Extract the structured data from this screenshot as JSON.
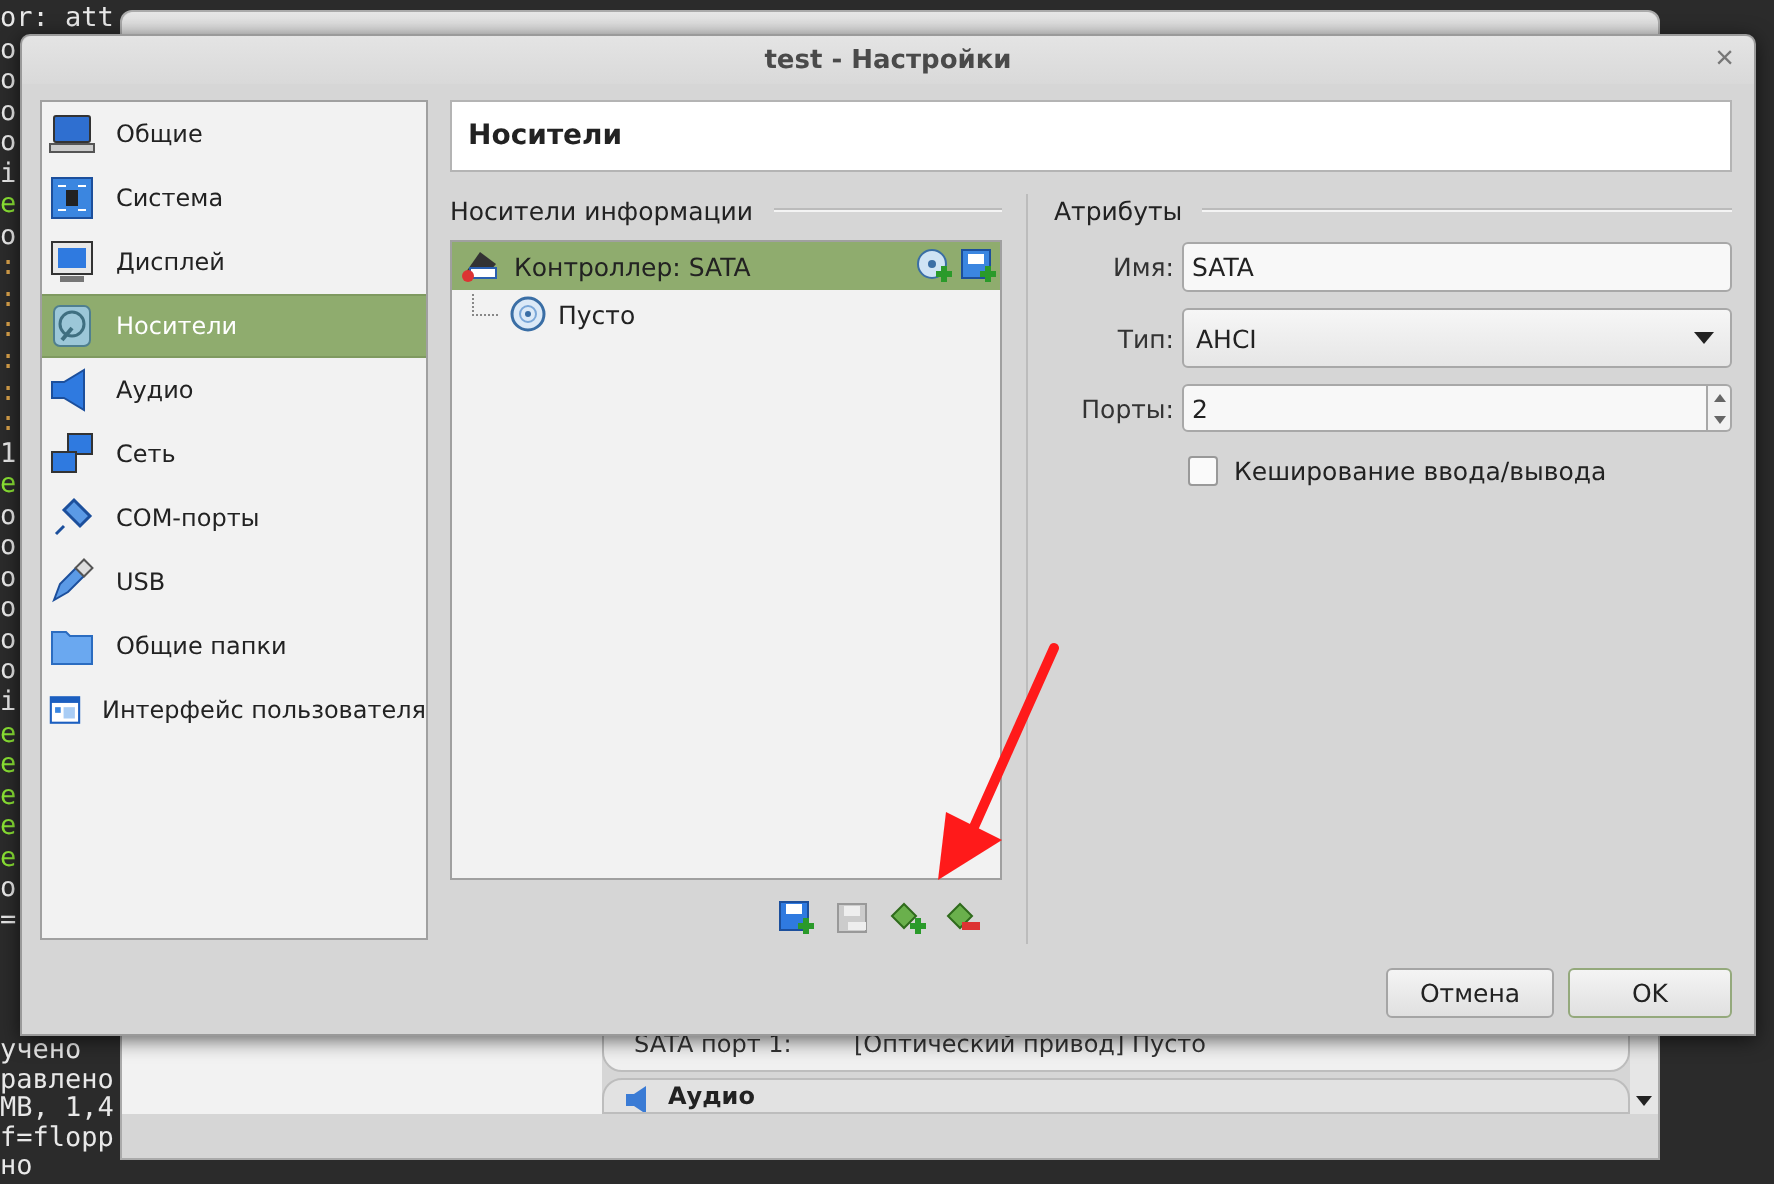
{
  "terminal": {
    "top_lines": [
      {
        "text": "or: att",
        "color": "#e8e8e8"
      },
      {
        "text": "o",
        "color": "#e8e8e8"
      },
      {
        "text": "o",
        "color": "#e8e8e8"
      },
      {
        "text": "o",
        "color": "#e8e8e8"
      },
      {
        "text": "o",
        "color": "#e8e8e8"
      },
      {
        "text": "i",
        "color": "#e8e8e8"
      },
      {
        "text": "e",
        "color": "#8ae234"
      },
      {
        "text": "o",
        "color": "#e8e8e8"
      },
      {
        "text": ":",
        "color": "#d7a04a"
      },
      {
        "text": ":",
        "color": "#d7a04a"
      },
      {
        "text": ":",
        "color": "#d7a04a"
      },
      {
        "text": ":",
        "color": "#d7a04a"
      },
      {
        "text": ":",
        "color": "#d7a04a"
      },
      {
        "text": ":",
        "color": "#d7a04a"
      },
      {
        "text": "1",
        "color": "#e8e8e8"
      },
      {
        "text": "e",
        "color": "#8ae234"
      },
      {
        "text": "o",
        "color": "#e8e8e8"
      },
      {
        "text": "o",
        "color": "#e8e8e8"
      },
      {
        "text": "o",
        "color": "#e8e8e8"
      },
      {
        "text": "o",
        "color": "#e8e8e8"
      },
      {
        "text": "o",
        "color": "#e8e8e8"
      },
      {
        "text": "o",
        "color": "#e8e8e8"
      },
      {
        "text": "i",
        "color": "#e8e8e8"
      },
      {
        "text": "e",
        "color": "#8ae234"
      },
      {
        "text": "e",
        "color": "#8ae234"
      },
      {
        "text": "e",
        "color": "#8ae234"
      },
      {
        "text": "e",
        "color": "#8ae234"
      },
      {
        "text": "e",
        "color": "#8ae234"
      },
      {
        "text": "o",
        "color": "#e8e8e8"
      },
      {
        "text": "=",
        "color": "#e8e8e8"
      }
    ],
    "bottom_lines": [
      {
        "text": "учено",
        "color": "#e8e8e8"
      },
      {
        "text": "равлено",
        "color": "#e8e8e8"
      },
      {
        "text": "MB, 1,4",
        "color": "#e8e8e8"
      },
      {
        "text": "f=flopp",
        "color": "#e8e8e8"
      },
      {
        "text": "но",
        "color": "#e8e8e8"
      }
    ]
  },
  "background_window": {
    "detail_rows": [
      {
        "label": "SATA порт 1:",
        "value": "[Оптический привод] Пусто"
      }
    ],
    "section": "Аудио"
  },
  "dialog": {
    "title": "test - Настройки",
    "close_glyph": "×",
    "sidebar": {
      "items": [
        {
          "label": "Общие",
          "selected": false
        },
        {
          "label": "Система",
          "selected": false
        },
        {
          "label": "Дисплей",
          "selected": false
        },
        {
          "label": "Носители",
          "selected": true
        },
        {
          "label": "Аудио",
          "selected": false
        },
        {
          "label": "Сеть",
          "selected": false
        },
        {
          "label": "COM-порты",
          "selected": false
        },
        {
          "label": "USB",
          "selected": false
        },
        {
          "label": "Общие папки",
          "selected": false
        },
        {
          "label": "Интерфейс пользователя",
          "selected": false
        }
      ]
    },
    "page_title": "Носители",
    "storage": {
      "heading": "Носители информации",
      "tree": [
        {
          "label": "Контроллер: SATA",
          "selected": true,
          "children": [
            {
              "label": "Пусто",
              "selected": false
            }
          ]
        }
      ]
    },
    "attributes": {
      "heading": "Атрибуты",
      "fields": [
        {
          "kind": "text",
          "label": "Имя:",
          "value": "SATA"
        },
        {
          "kind": "combo",
          "label": "Тип:",
          "value": "AHCI"
        },
        {
          "kind": "spin",
          "label": "Порты:",
          "value": "2"
        }
      ],
      "checkbox": {
        "label": "Кеширование ввода/вывода",
        "checked": false
      }
    },
    "buttons": [
      {
        "label": "Отмена",
        "default": false
      },
      {
        "label": "OK",
        "default": true
      }
    ]
  },
  "overlay": {
    "kind": "arrow",
    "color": "#ff1a1a"
  }
}
